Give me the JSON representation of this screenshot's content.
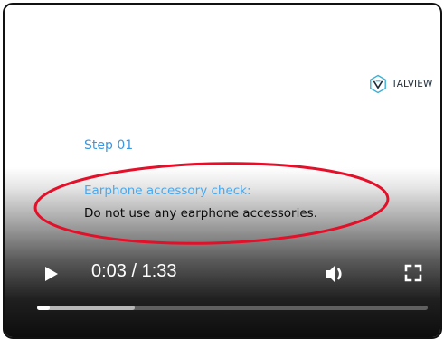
{
  "brand": {
    "name": "TALVIEW",
    "icon": "talview-logo-icon"
  },
  "lesson": {
    "step": "Step 01",
    "check_title": "Earphone accessory check:",
    "check_body": "Do not use any earphone accessories."
  },
  "player": {
    "time": "0:03 / 1:33",
    "icons": {
      "play": "play-icon",
      "volume": "volume-icon",
      "fullscreen": "fullscreen-icon"
    },
    "progress_played_fraction": 0.032,
    "progress_buffered_fraction": 0.25
  },
  "colors": {
    "step_text": "#3a98e0",
    "check_title_text": "#48a9f0",
    "annotation_ellipse": "#e4102a",
    "brand_accent": "#3ab0d8"
  }
}
